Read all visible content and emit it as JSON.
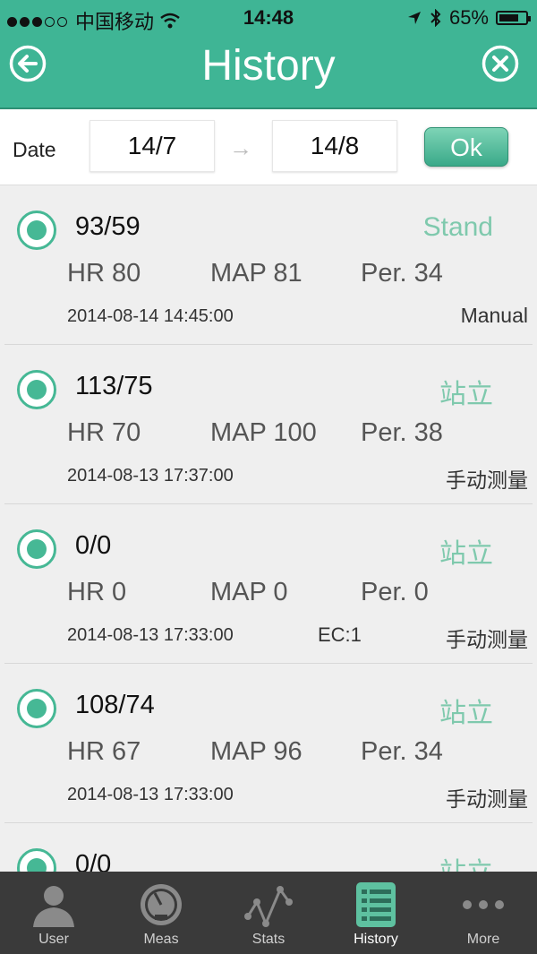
{
  "status_bar": {
    "carrier": "中国移动",
    "time": "14:48",
    "battery": "65%"
  },
  "header": {
    "title": "History"
  },
  "filter": {
    "label": "Date",
    "from": "14/7",
    "to": "14/8",
    "arrow": "→",
    "ok_label": "Ok"
  },
  "records": [
    {
      "bp": "93/59",
      "posture": "Stand",
      "hr": "HR 80",
      "map": "MAP 81",
      "per": "Per. 34",
      "timestamp": "2014-08-14 14:45:00",
      "ec": "",
      "mode": "Manual"
    },
    {
      "bp": "113/75",
      "posture": "站立",
      "hr": "HR 70",
      "map": "MAP 100",
      "per": "Per. 38",
      "timestamp": "2014-08-13 17:37:00",
      "ec": "",
      "mode": "手动测量"
    },
    {
      "bp": "0/0",
      "posture": "站立",
      "hr": "HR 0",
      "map": "MAP 0",
      "per": "Per. 0",
      "timestamp": "2014-08-13 17:33:00",
      "ec": "EC:1",
      "mode": "手动测量"
    },
    {
      "bp": "108/74",
      "posture": "站立",
      "hr": "HR 67",
      "map": "MAP 96",
      "per": "Per. 34",
      "timestamp": "2014-08-13 17:33:00",
      "ec": "",
      "mode": "手动测量"
    },
    {
      "bp": "0/0",
      "posture": "站立",
      "hr": "",
      "map": "",
      "per": "",
      "timestamp": "",
      "ec": "",
      "mode": ""
    }
  ],
  "tabs": [
    {
      "label": "User",
      "icon": "user-icon"
    },
    {
      "label": "Meas",
      "icon": "gauge-icon"
    },
    {
      "label": "Stats",
      "icon": "line-chart-icon"
    },
    {
      "label": "History",
      "icon": "history-list-icon",
      "active": true
    },
    {
      "label": "More",
      "icon": "more-dots-icon"
    }
  ],
  "colors": {
    "accent": "#3fb595",
    "posture": "#7fc9ad",
    "tabbar": "#3a3a3a"
  }
}
